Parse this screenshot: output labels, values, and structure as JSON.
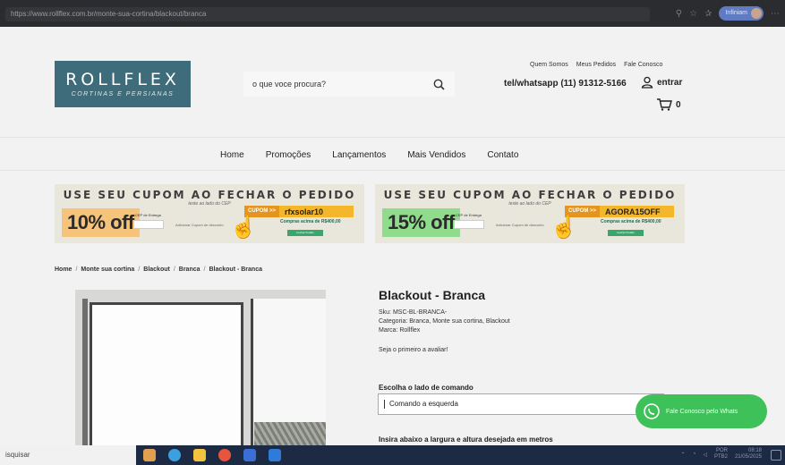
{
  "browser": {
    "url": "https://www.rollflex.com.br/monte-sua-cortina/blackout/branca",
    "profile_label": "Infiniam"
  },
  "header": {
    "logo_name": "ROLLFLEX",
    "logo_tagline": "CORTINAS E PERSIANAS",
    "search_placeholder": "o que voce procura?",
    "top_links": [
      "Quem Somos",
      "Meus Pedidos",
      "Fale Conosco"
    ],
    "phone": "tel/whatsapp (11) 91312-5166",
    "login_label": "entrar",
    "cart_count": "0"
  },
  "nav": {
    "items": [
      "Home",
      "Promoções",
      "Lançamentos",
      "Mais Vendidos",
      "Contato"
    ]
  },
  "banners": [
    {
      "headline": "USE SEU CUPOM AO FECHAR O PEDIDO",
      "subline": "teste ao lado do CEP",
      "discount": "10% off",
      "cep_label": "CEP de Entrega",
      "calc_label": "Adicionar Cupom de desconto",
      "coupon_label": "CUPOM >>",
      "coupon_code": "rfxsolar10",
      "minimum": "Compras acima de R$400,00",
      "button_label": "Fechar Pedido",
      "accent": "#f5c37a"
    },
    {
      "headline": "USE SEU CUPOM AO FECHAR O PEDIDO",
      "subline": "teste ao lado do CEP",
      "discount": "15% off",
      "cep_label": "CEP de Entrega",
      "calc_label": "Adicionar Cupom de desconto",
      "coupon_label": "CUPOM >>",
      "coupon_code": "AGORA15OFF",
      "minimum": "Compras acima de R$400,00",
      "button_label": "Fechar Pedido",
      "accent": "#8fdc8c"
    }
  ],
  "breadcrumb": [
    "Home",
    "Monte sua cortina",
    "Blackout",
    "Branca",
    "Blackout - Branca"
  ],
  "product": {
    "title": "Blackout - Branca",
    "sku": "Sku: MSC-BL-BRANCA-",
    "category": "Categoria: Branca,  Monte sua cortina,  Blackout",
    "brand": "Marca: Rollflex",
    "rating_text": "Seja o primeiro a avaliar!",
    "side_label": "Escolha o lado de comando",
    "side_value": "Comando a esquerda",
    "size_label": "Insira abaixo a largura e altura desejada em metros"
  },
  "whatsapp": {
    "label": "Fale Conosco pelo Whats",
    "color": "#3fc159"
  },
  "taskbar": {
    "search_text": "isquisar",
    "lang": "POR",
    "lang2": "PTB2",
    "time": "08:18",
    "date": "21/05/2025"
  },
  "colors": {
    "brand": "#3e6c7a",
    "taskbar": "#1d2a44"
  }
}
